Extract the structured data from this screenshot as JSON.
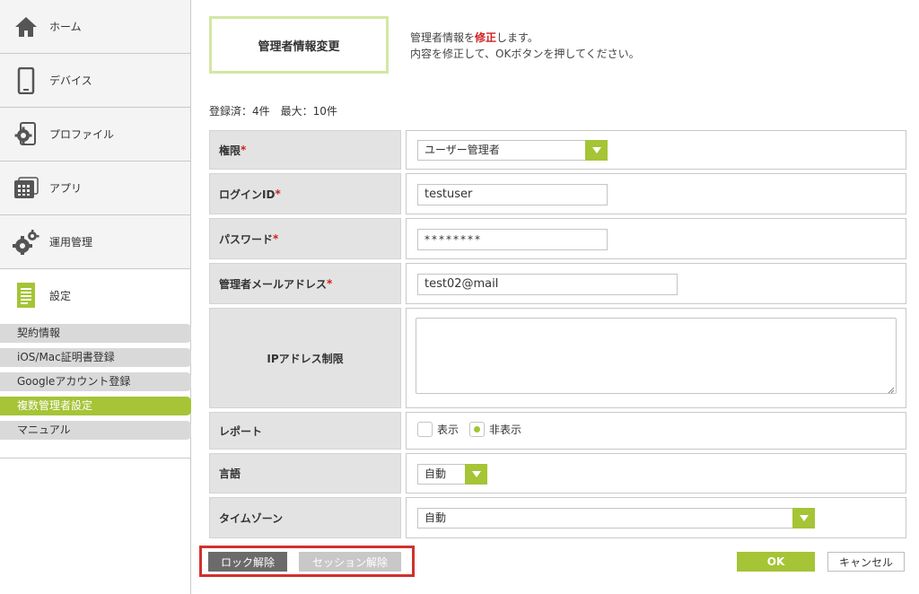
{
  "sidebar": {
    "nav": [
      {
        "label": "ホーム",
        "icon": "home-icon"
      },
      {
        "label": "デバイス",
        "icon": "smartphone-icon"
      },
      {
        "label": "プロファイル",
        "icon": "profile-gear-icon"
      },
      {
        "label": "アプリ",
        "icon": "app-grid-icon"
      },
      {
        "label": "運用管理",
        "icon": "gears-icon"
      },
      {
        "label": "設定",
        "icon": "document-icon"
      }
    ],
    "sub_items": [
      "契約情報",
      "iOS/Mac証明書登録",
      "Googleアカウント登録",
      "複数管理者設定",
      "マニュアル"
    ],
    "selected_sub_item": "複数管理者設定"
  },
  "header": {
    "title": "管理者情報変更",
    "instructions": {
      "line1_pre": "管理者情報を",
      "line1_emph": "修正",
      "line1_post": "します。",
      "line2": "内容を修正して、OKボタンを押してください。"
    }
  },
  "count": {
    "registered": "登録済：4件",
    "max": "最大：10件"
  },
  "form": {
    "required_mark": "*",
    "authority": {
      "label": "権限",
      "value": "ユーザー管理者"
    },
    "login_id": {
      "label": "ログインID",
      "value": "testuser"
    },
    "password": {
      "label": "パスワード",
      "value": "********"
    },
    "email": {
      "label": "管理者メールアドレス",
      "value": "test02@mail"
    },
    "ip_restriction": {
      "label": "IPアドレス制限",
      "value": ""
    },
    "report": {
      "label": "レポート",
      "options": [
        "表示",
        "非表示"
      ],
      "selected": "非表示"
    },
    "language": {
      "label": "言語",
      "value": "自動"
    },
    "timezone": {
      "label": "タイムゾーン",
      "value": "自動"
    }
  },
  "buttons": {
    "unlock": "ロック解除",
    "session_release": "セッション解除",
    "ok": "OK",
    "cancel": "キャンセル"
  },
  "colors": {
    "accent": "#a5c436",
    "required": "#d02020",
    "highlight_frame": "#d0312d",
    "title_border": "#d3e7a3"
  }
}
